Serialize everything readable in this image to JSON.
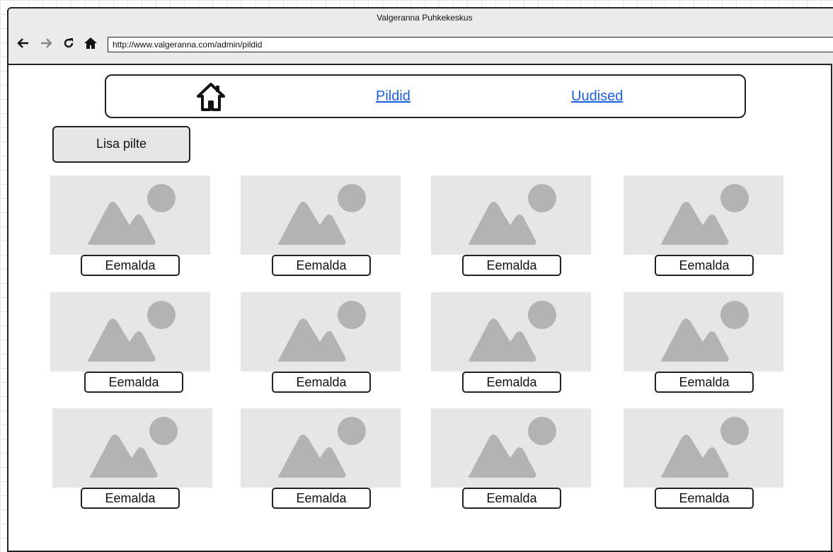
{
  "window": {
    "title": "Valgeranna Puhkekeskus",
    "url": "http://www.valgeranna.com/admin/pildid"
  },
  "menu": {
    "home_icon": "home-icon",
    "links": [
      "Pildid",
      "Uudised"
    ]
  },
  "toolbar": {
    "add_label": "Lisa pilte"
  },
  "gallery": {
    "image_icon": "image-placeholder-icon",
    "remove_label": "Eemalda",
    "rows": 3,
    "cols": 4
  },
  "colors": {
    "link": "#1a5fe0",
    "placeholder_bg": "#e6e6e6",
    "placeholder_shape": "#b3b3b3"
  }
}
